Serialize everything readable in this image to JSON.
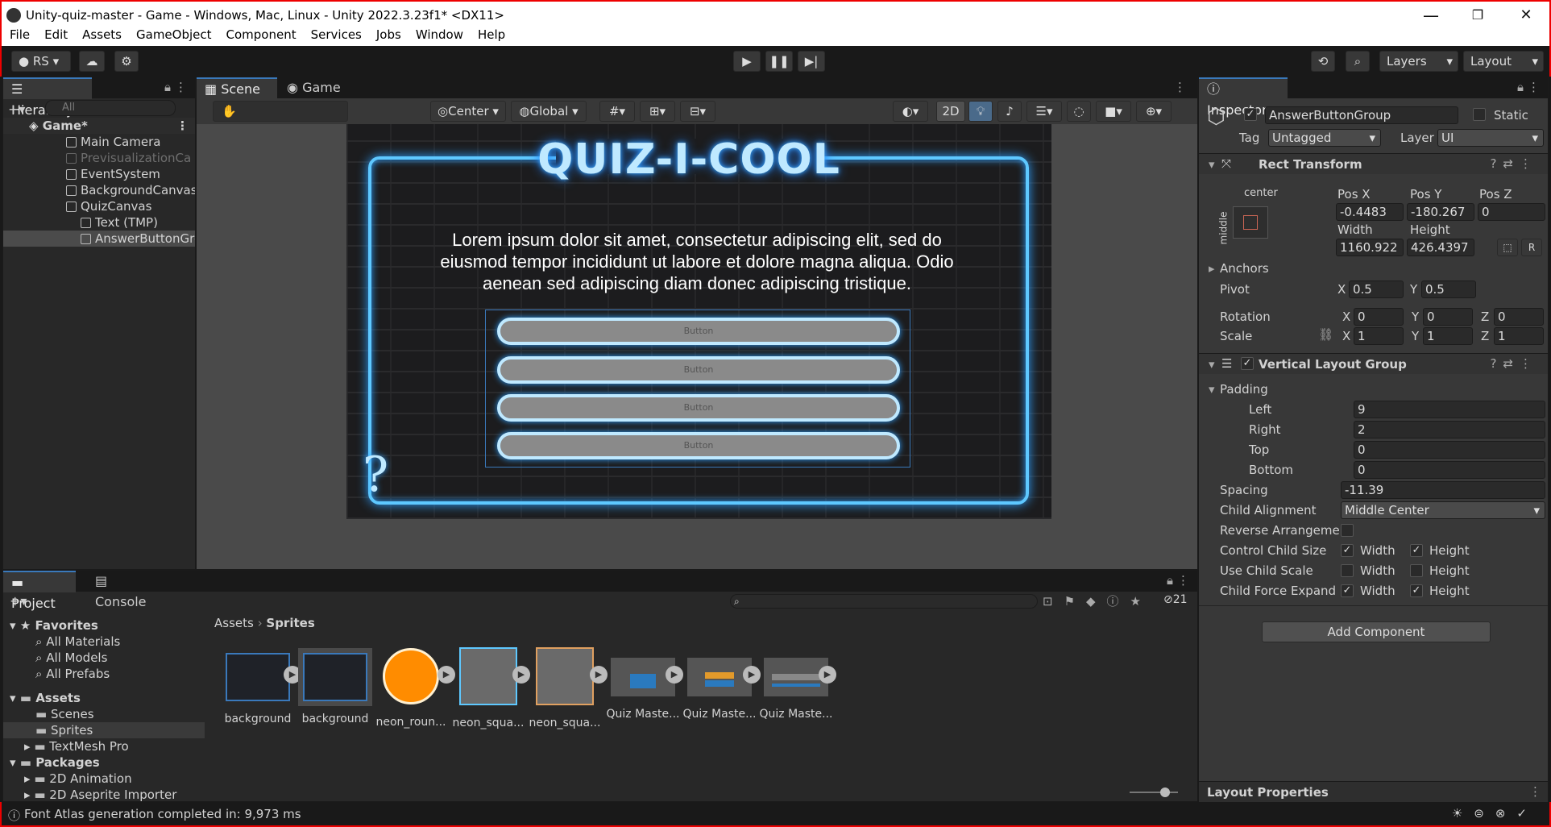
{
  "window": {
    "title": "Unity-quiz-master - Game - Windows, Mac, Linux - Unity 2022.3.23f1* <DX11>",
    "min": "—",
    "restore": "❐",
    "close": "✕"
  },
  "menu": [
    "File",
    "Edit",
    "Assets",
    "GameObject",
    "Component",
    "Services",
    "Jobs",
    "Window",
    "Help"
  ],
  "toolbar": {
    "account": "RS",
    "layers": "Layers",
    "layout": "Layout"
  },
  "hierarchy": {
    "tab": "Hierarchy",
    "search_placeholder": "All",
    "items": [
      {
        "label": "Game*"
      },
      {
        "label": "Main Camera"
      },
      {
        "label": "PrevisualizationCa"
      },
      {
        "label": "EventSystem"
      },
      {
        "label": "BackgroundCanvas"
      },
      {
        "label": "QuizCanvas"
      },
      {
        "label": "Text (TMP)"
      },
      {
        "label": "AnswerButtonGro"
      }
    ]
  },
  "scene": {
    "tab_scene": "Scene",
    "tab_game": "Game",
    "pivot": "Center",
    "space": "Global",
    "mode2d": "2D",
    "quiz_title": "QUIZ-I-COOL",
    "question": "Lorem ipsum dolor sit amet, consectetur adipiscing elit, sed do eiusmod tempor incididunt ut labore et dolore magna aliqua. Odio aenean sed adipiscing diam donec adipiscing tristique.",
    "buttons": [
      "Button",
      "Button",
      "Button",
      "Button"
    ],
    "qmark": "?"
  },
  "inspector": {
    "tab": "Inspector",
    "object_name": "AnswerButtonGroup",
    "static": "Static",
    "tag_label": "Tag",
    "tag": "Untagged",
    "layer_label": "Layer",
    "layer": "UI",
    "rect": {
      "title": "Rect Transform",
      "anchor": "center",
      "anchor_side": "middle",
      "posx_l": "Pos X",
      "posy_l": "Pos Y",
      "posz_l": "Pos Z",
      "posx": "-0.4483",
      "posy": "-180.267",
      "posz": "0",
      "w_l": "Width",
      "h_l": "Height",
      "w": "1160.922",
      "h": "426.4397",
      "r": "R",
      "anchors": "Anchors",
      "pivot": "Pivot",
      "pivx": "0.5",
      "pivy": "0.5",
      "rotation": "Rotation",
      "rx": "0",
      "ry": "0",
      "rz": "0",
      "scale": "Scale",
      "sx": "1",
      "sy": "1",
      "sz": "1",
      "X": "X",
      "Y": "Y",
      "Z": "Z"
    },
    "vlg": {
      "title": "Vertical Layout Group",
      "padding": "Padding",
      "left_l": "Left",
      "left": "9",
      "right_l": "Right",
      "right": "2",
      "top_l": "Top",
      "top": "0",
      "bottom_l": "Bottom",
      "bottom": "0",
      "spacing_l": "Spacing",
      "spacing": "-11.39",
      "align_l": "Child Alignment",
      "align": "Middle Center",
      "reverse": "Reverse Arrangemen",
      "ccs": "Control Child Size",
      "ucs": "Use Child Scale",
      "cfe": "Child Force Expand",
      "width": "Width",
      "height": "Height"
    },
    "add_component": "Add Component",
    "layout_props": "Layout Properties"
  },
  "project": {
    "tab_project": "Project",
    "tab_console": "Console",
    "hidden_count": "21",
    "tree": [
      {
        "label": "Favorites"
      },
      {
        "label": "All Materials"
      },
      {
        "label": "All Models"
      },
      {
        "label": "All Prefabs"
      },
      {
        "label": "Assets"
      },
      {
        "label": "Scenes"
      },
      {
        "label": "Sprites"
      },
      {
        "label": "TextMesh Pro"
      },
      {
        "label": "Packages"
      },
      {
        "label": "2D Animation"
      },
      {
        "label": "2D Aseprite Importer"
      }
    ],
    "breadcrumb": [
      "Assets",
      "Sprites"
    ],
    "assets": [
      "background",
      "background",
      "neon_roun...",
      "neon_squa...",
      "neon_squa...",
      "Quiz Maste...",
      "Quiz Maste...",
      "Quiz Maste..."
    ]
  },
  "status": {
    "text": "Font Atlas generation completed in: 9,973 ms"
  },
  "colors": {
    "accent": "#3a79bb",
    "neon": "#5ec8ff",
    "orange": "#ff8c00"
  }
}
